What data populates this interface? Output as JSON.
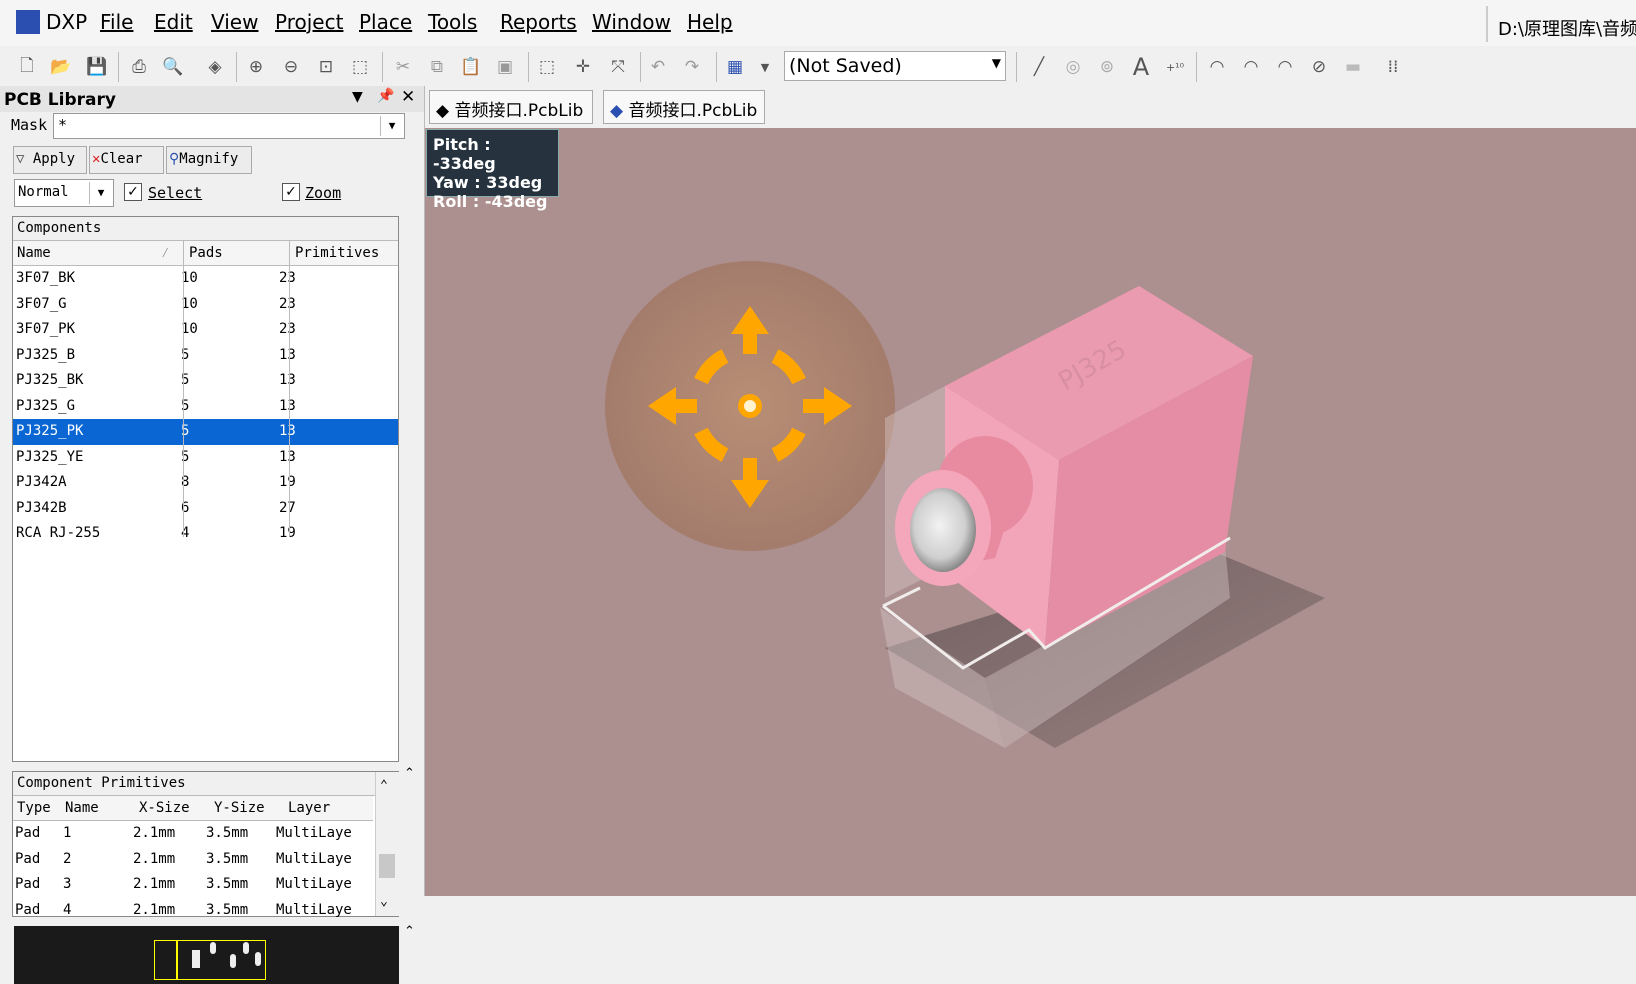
{
  "menubar": {
    "app": "DXP",
    "items": [
      {
        "label": "File"
      },
      {
        "label": "Edit"
      },
      {
        "label": "View"
      },
      {
        "label": "Project"
      },
      {
        "label": "Place"
      },
      {
        "label": "Tools"
      },
      {
        "label": "Reports"
      },
      {
        "label": "Window"
      },
      {
        "label": "Help"
      }
    ],
    "path": "D:\\原理图库\\音频"
  },
  "toolbar": {
    "view_config": "(Not Saved)"
  },
  "panel": {
    "title": "PCB Library",
    "mask_label": "Mask",
    "mask_value": "*",
    "apply": "Apply",
    "clear": "Clear",
    "magnify": "Magnify",
    "mode": "Normal",
    "select": "Select",
    "zoom": "Zoom",
    "components": {
      "header": "Components",
      "columns": [
        "Name",
        "Pads",
        "Primitives"
      ],
      "rows": [
        [
          "3F07_BK",
          "10",
          "23"
        ],
        [
          "3F07_G",
          "10",
          "23"
        ],
        [
          "3F07_PK",
          "10",
          "23"
        ],
        [
          "PJ325_B",
          "5",
          "13"
        ],
        [
          "PJ325_BK",
          "5",
          "13"
        ],
        [
          "PJ325_G",
          "5",
          "13"
        ],
        [
          "PJ325_PK",
          "5",
          "13"
        ],
        [
          "PJ325_YE",
          "5",
          "13"
        ],
        [
          "PJ342A",
          "8",
          "19"
        ],
        [
          "PJ342B",
          "6",
          "27"
        ],
        [
          "RCA RJ-255",
          "4",
          "19"
        ]
      ],
      "selected_index": 6
    },
    "primitives": {
      "header": "Component Primitives",
      "columns": [
        "Type",
        "Name",
        "X-Size",
        "Y-Size",
        "Layer"
      ],
      "rows": [
        [
          "Pad",
          "1",
          "2.1mm",
          "3.5mm",
          "MultiLaye"
        ],
        [
          "Pad",
          "2",
          "2.1mm",
          "3.5mm",
          "MultiLaye"
        ],
        [
          "Pad",
          "3",
          "2.1mm",
          "3.5mm",
          "MultiLaye"
        ],
        [
          "Pad",
          "4",
          "2.1mm",
          "3.5mm",
          "MultiLaye"
        ]
      ]
    }
  },
  "tabs": [
    {
      "label": "音频接口.PcbLib"
    },
    {
      "label": "音频接口.PcbLib"
    }
  ],
  "hud": {
    "pitch": "Pitch : -33deg",
    "yaw": "Yaw : 33deg",
    "roll": "Roll : -43deg"
  },
  "model": {
    "silkscreen": "PJ325"
  },
  "colors": {
    "viewport_bg": "#ac8f8f",
    "selection": "#0a66d3",
    "body_pink": "#e48ea2",
    "navigator_orange": "#ffa600"
  }
}
